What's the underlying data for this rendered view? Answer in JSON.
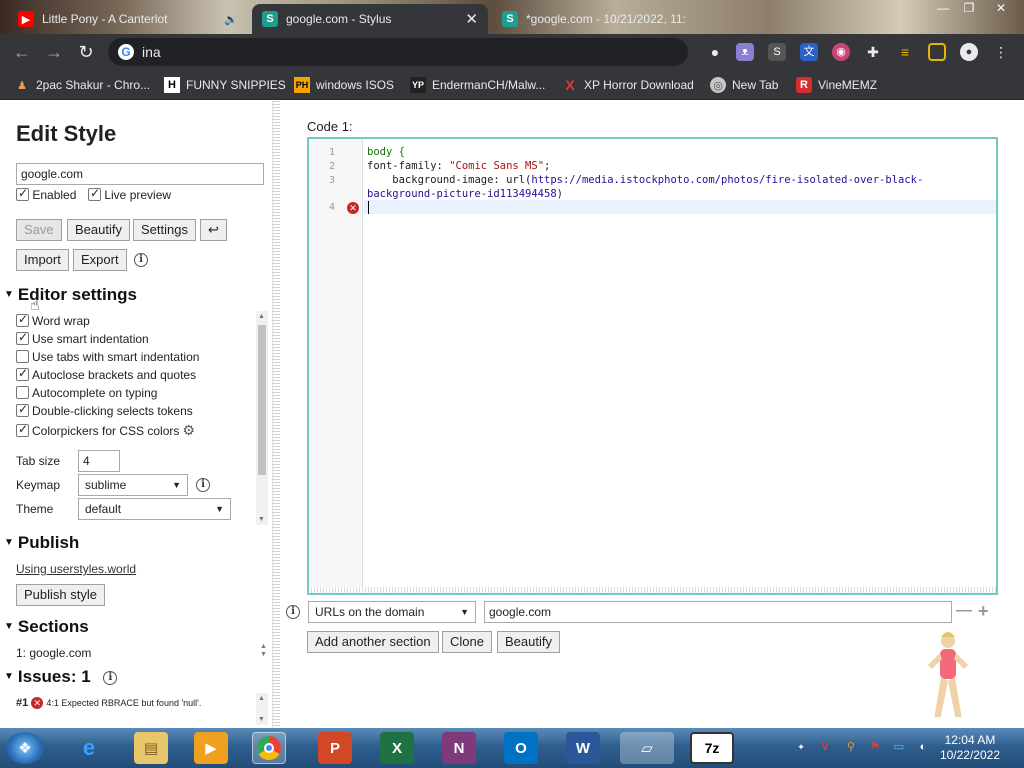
{
  "browser": {
    "tabs": [
      {
        "title": "Little Pony - A Canterlot",
        "active": false
      },
      {
        "title": "google.com - Stylus",
        "active": true
      },
      {
        "title": "*google.com - 10/21/2022, 11:",
        "active": false
      }
    ],
    "address": "ina",
    "bookmarks": [
      {
        "label": "2pac Shakur - Chro..."
      },
      {
        "label": "FUNNY SNIPPIES"
      },
      {
        "label": "windows ISOS"
      },
      {
        "label": "EndermanCH/Malw..."
      },
      {
        "label": "XP Horror Download"
      },
      {
        "label": "New Tab"
      },
      {
        "label": "VineMEMZ"
      }
    ]
  },
  "sidebar": {
    "title": "Edit Style",
    "style_name": "google.com",
    "enabled_label": "Enabled",
    "live_preview_label": "Live preview",
    "buttons": {
      "save": "Save",
      "beautify": "Beautify",
      "settings": "Settings",
      "undo": "↩",
      "import": "Import",
      "export": "Export"
    },
    "editor_settings": {
      "heading": "Editor settings",
      "options": [
        {
          "label": "Word wrap",
          "checked": true
        },
        {
          "label": "Use smart indentation",
          "checked": true
        },
        {
          "label": "Use tabs with smart indentation",
          "checked": false
        },
        {
          "label": "Autoclose brackets and quotes",
          "checked": true
        },
        {
          "label": "Autocomplete on typing",
          "checked": false
        },
        {
          "label": "Double-clicking selects tokens",
          "checked": true
        },
        {
          "label": "Colorpickers for CSS colors",
          "checked": true
        }
      ],
      "tab_size_label": "Tab size",
      "tab_size_value": "4",
      "keymap_label": "Keymap",
      "keymap_value": "sublime",
      "theme_label": "Theme",
      "theme_value": "default"
    },
    "publish": {
      "heading": "Publish",
      "link": "Using userstyles.world",
      "button": "Publish style"
    },
    "sections": {
      "heading": "Sections",
      "item": "1: google.com"
    },
    "issues": {
      "heading": "Issues: 1",
      "number": "#1",
      "message": "4:1  Expected RBRACE but found 'null'."
    }
  },
  "editor": {
    "label": "Code 1:",
    "line_numbers": [
      "1",
      "2",
      "3",
      "4"
    ],
    "line1": "body {",
    "line2_prop": "font-family: ",
    "line2_val": "\"Comic Sans MS\"",
    "line2_end": ";",
    "line3_prop": "    background-image: url(",
    "line3_url_a": "https://media.istockphoto.com/photos/fire-isolated-over-black-",
    "line3_url_b": "background-picture-id113494458",
    "line3_end": ")"
  },
  "applies": {
    "type_value": "URLs on the domain",
    "domain_value": "google.com",
    "add_section": "Add another section",
    "clone": "Clone",
    "beautify": "Beautify"
  },
  "taskbar": {
    "time": "12:04 AM",
    "date": "10/22/2022"
  },
  "colors": {
    "accent_border": "#6fcbc4",
    "error": "#c62828"
  }
}
